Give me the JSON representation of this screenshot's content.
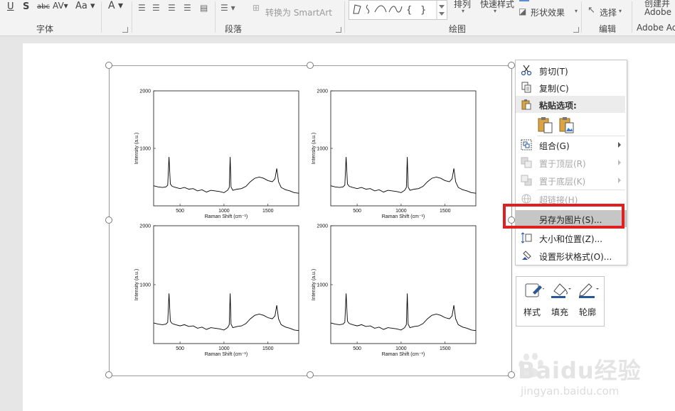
{
  "ribbon": {
    "font_group_label": "字体",
    "paragraph_group_label": "段落",
    "drawing_group_label": "绘图",
    "edit_group_label": "编辑",
    "adobe_group_label": "Adobe Ac",
    "convert_smartart": "转换为 SmartArt",
    "arrange": "排列",
    "quick_styles": "快速样式",
    "shape_effects": "形状效果",
    "select": "选择",
    "create_share": "创建并",
    "adobe_top": "Adobe"
  },
  "chart_data": [
    {
      "type": "line",
      "xlabel": "Raman Shift (cm⁻¹)",
      "ylabel": "Intensity (a.u.)",
      "xticks": [
        500,
        1000,
        1500
      ],
      "yticks": [
        1000,
        2000
      ],
      "xlim": [
        200,
        1850
      ],
      "ylim": [
        0,
        2000
      ],
      "series": [
        {
          "x": [
            200,
            250,
            300,
            340,
            360,
            375,
            390,
            410,
            450,
            500,
            550,
            600,
            650,
            700,
            750,
            800,
            850,
            900,
            950,
            1000,
            1040,
            1060,
            1070,
            1080,
            1100,
            1150,
            1200,
            1250,
            1300,
            1350,
            1400,
            1450,
            1500,
            1550,
            1580,
            1600,
            1620,
            1650,
            1700,
            1750,
            1800,
            1850
          ],
          "y": [
            350,
            330,
            320,
            330,
            360,
            850,
            380,
            340,
            320,
            300,
            320,
            290,
            300,
            260,
            280,
            240,
            270,
            260,
            250,
            230,
            270,
            320,
            850,
            330,
            270,
            290,
            300,
            340,
            420,
            480,
            500,
            480,
            440,
            420,
            470,
            650,
            420,
            320,
            280,
            260,
            230,
            220
          ]
        }
      ]
    },
    {
      "type": "line",
      "xlabel": "Raman Shift (cm⁻¹)",
      "ylabel": "Intensity (a.u.)",
      "xticks": [
        500,
        1000,
        1500
      ],
      "yticks": [
        1000,
        2000
      ],
      "xlim": [
        200,
        1850
      ],
      "ylim": [
        0,
        2000
      ],
      "series": [
        {
          "x": [
            200,
            250,
            300,
            340,
            360,
            375,
            390,
            410,
            450,
            500,
            550,
            600,
            650,
            700,
            750,
            800,
            850,
            900,
            950,
            1000,
            1040,
            1060,
            1070,
            1080,
            1100,
            1150,
            1200,
            1250,
            1300,
            1350,
            1400,
            1450,
            1500,
            1550,
            1580,
            1600,
            1620,
            1650,
            1700,
            1750,
            1800,
            1850
          ],
          "y": [
            350,
            330,
            320,
            330,
            360,
            850,
            380,
            340,
            320,
            300,
            320,
            290,
            300,
            260,
            280,
            240,
            270,
            260,
            250,
            230,
            270,
            320,
            850,
            330,
            270,
            290,
            300,
            340,
            420,
            480,
            500,
            480,
            440,
            420,
            470,
            650,
            420,
            320,
            280,
            260,
            230,
            220
          ]
        }
      ]
    },
    {
      "type": "line",
      "xlabel": "Raman Shift (cm⁻¹)",
      "ylabel": "Intensity (a.u.)",
      "xticks": [
        500,
        1000,
        1500
      ],
      "yticks": [
        1000,
        2000
      ],
      "xlim": [
        200,
        1850
      ],
      "ylim": [
        0,
        2000
      ],
      "series": [
        {
          "x": [
            200,
            250,
            300,
            340,
            360,
            375,
            390,
            410,
            450,
            500,
            550,
            600,
            650,
            700,
            750,
            800,
            850,
            900,
            950,
            1000,
            1040,
            1060,
            1070,
            1080,
            1100,
            1150,
            1200,
            1250,
            1300,
            1350,
            1400,
            1450,
            1500,
            1550,
            1580,
            1600,
            1620,
            1650,
            1700,
            1750,
            1800,
            1850
          ],
          "y": [
            350,
            330,
            320,
            330,
            360,
            850,
            380,
            340,
            320,
            300,
            320,
            290,
            300,
            260,
            280,
            240,
            270,
            260,
            250,
            230,
            270,
            320,
            850,
            330,
            270,
            290,
            300,
            340,
            420,
            480,
            500,
            480,
            440,
            420,
            470,
            650,
            420,
            320,
            280,
            260,
            230,
            220
          ]
        }
      ]
    },
    {
      "type": "line",
      "xlabel": "Raman Shift (cm⁻¹)",
      "ylabel": "Intensity (a.u.)",
      "xticks": [
        500,
        1000,
        1500
      ],
      "yticks": [
        1000,
        2000
      ],
      "xlim": [
        200,
        1850
      ],
      "ylim": [
        0,
        2000
      ],
      "series": [
        {
          "x": [
            200,
            250,
            300,
            340,
            360,
            375,
            390,
            410,
            450,
            500,
            550,
            600,
            650,
            700,
            750,
            800,
            850,
            900,
            950,
            1000,
            1040,
            1060,
            1070,
            1080,
            1100,
            1150,
            1200,
            1250,
            1300,
            1350,
            1400,
            1450,
            1500,
            1550,
            1580,
            1600,
            1620,
            1650,
            1700,
            1750,
            1800,
            1850
          ],
          "y": [
            350,
            330,
            320,
            330,
            360,
            850,
            380,
            340,
            320,
            300,
            320,
            290,
            300,
            260,
            280,
            240,
            270,
            260,
            250,
            230,
            270,
            320,
            850,
            330,
            270,
            290,
            300,
            340,
            420,
            480,
            500,
            480,
            440,
            420,
            470,
            650,
            420,
            320,
            280,
            260,
            230,
            220
          ]
        }
      ]
    }
  ],
  "context_menu": {
    "cut": "剪切(T)",
    "copy": "复制(C)",
    "paste_options": "粘贴选项:",
    "group": "组合(G)",
    "bring_to_front": "置于顶层(R)",
    "send_to_back": "置于底层(K)",
    "hyperlink": "超链接(H)",
    "save_as_picture": "另存为图片(S)...",
    "size_position": "大小和位置(Z)...",
    "format_shape": "设置形状格式(O)..."
  },
  "mini_toolbar": {
    "style": "样式",
    "fill": "填充",
    "outline": "轮廓"
  },
  "watermark": {
    "brand": "Baidu经验",
    "url": "jingyan.baidu.com"
  }
}
